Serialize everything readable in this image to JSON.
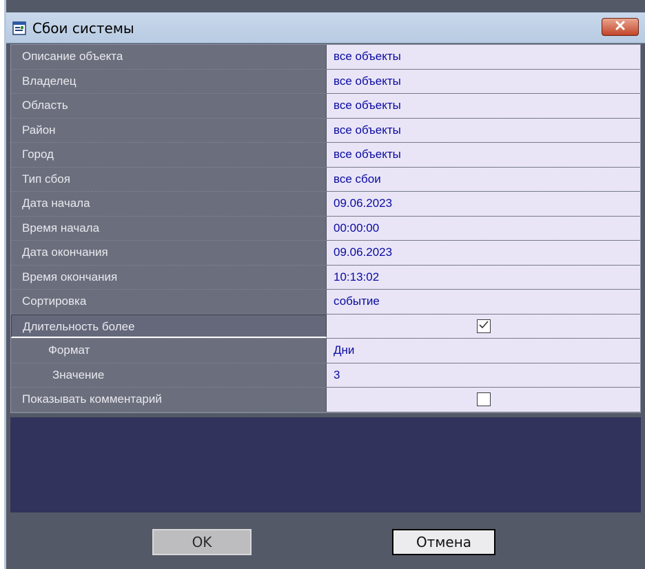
{
  "window": {
    "title": "Сбои системы",
    "close_icon": "close-icon"
  },
  "properties": [
    {
      "label": "Описание объекта",
      "value": "все объекты"
    },
    {
      "label": "Владелец",
      "value": "все объекты"
    },
    {
      "label": "Область",
      "value": "все объекты"
    },
    {
      "label": "Район",
      "value": "все объекты"
    },
    {
      "label": "Город",
      "value": "все объекты"
    },
    {
      "label": "Тип сбоя",
      "value": "все сбои"
    },
    {
      "label": "Дата начала",
      "value": "09.06.2023"
    },
    {
      "label": "Время начала",
      "value": "00:00:00"
    },
    {
      "label": "Дата окончания",
      "value": "09.06.2023"
    },
    {
      "label": "Время окончания",
      "value": "10:13:02"
    },
    {
      "label": "Сортировка",
      "value": "событие"
    },
    {
      "label": "Длительность более",
      "checked": true
    },
    {
      "label": "Формат",
      "value": "Дни"
    },
    {
      "label": "Значение",
      "value": "3"
    },
    {
      "label": "Показывать комментарий",
      "checked": false
    }
  ],
  "buttons": {
    "ok": "OK",
    "cancel": "Отмена"
  },
  "colors": {
    "value_text": "#0a0aa0",
    "label_bg": "#6b6f7d",
    "value_bg": "#e9e5f7",
    "empty_area": "#32335c",
    "close_button": "#c2452a"
  }
}
